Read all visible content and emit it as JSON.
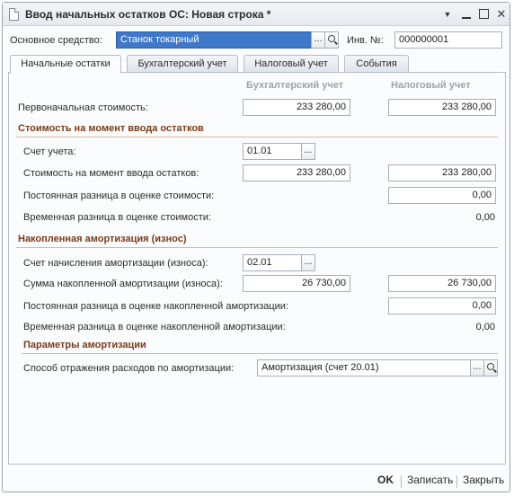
{
  "window": {
    "title": "Ввод начальных остатков ОС: Новая строка *"
  },
  "header": {
    "asset_label": "Основное средство:",
    "asset_value": "Станок токарный",
    "inv_label": "Инв. №:",
    "inv_value": "000000001",
    "select_btn": "..."
  },
  "tabs": [
    {
      "label": "Начальные остатки"
    },
    {
      "label": "Бухгалтерский учет"
    },
    {
      "label": "Налоговый учет"
    },
    {
      "label": "События"
    }
  ],
  "columns": {
    "accounting": "Бухгалтерский учет",
    "tax": "Налоговый учет"
  },
  "initial_cost": {
    "label": "Первоначальная стоимость:",
    "accounting": "233 280,00",
    "tax": "233 280,00"
  },
  "section_cost": {
    "title": "Стоимость на момент ввода остатков",
    "account_label": "Счет учета:",
    "account_value": "01.01",
    "cost_label": "Стоимость на момент ввода остатков:",
    "cost_accounting": "233 280,00",
    "cost_tax": "233 280,00",
    "perm_label": "Постоянная разница в оценке стоимости:",
    "perm_tax": "0,00",
    "temp_label": "Временная разница в оценке стоимости:",
    "temp_tax": "0,00"
  },
  "section_depr": {
    "title": "Накопленная амортизация (износ)",
    "account_label": "Счет начисления амортизации (износа):",
    "account_value": "02.01",
    "sum_label": "Сумма накопленной амортизации (износа):",
    "sum_accounting": "26 730,00",
    "sum_tax": "26 730,00",
    "perm_label": "Постоянная разница в оценке накопленной амортизации:",
    "perm_tax": "0,00",
    "temp_label": "Временная разница в оценке накопленной амортизации:",
    "temp_tax": "0,00"
  },
  "section_params": {
    "title": "Параметры амортизации",
    "method_label": "Способ отражения расходов по амортизации:",
    "method_value": "Амортизация (счет 20.01)"
  },
  "footer": {
    "ok": "OK",
    "save": "Записать",
    "close": "Закрыть"
  }
}
